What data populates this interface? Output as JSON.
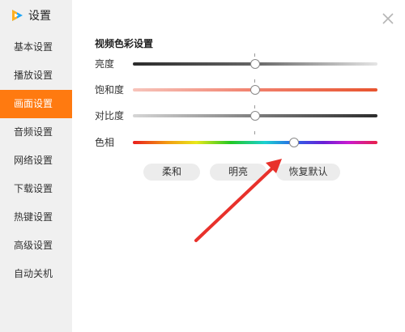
{
  "app": {
    "title": "设置",
    "logo_icon": "tencent-video-logo-icon",
    "accent_color": "#ff7a10"
  },
  "sidebar": {
    "items": [
      {
        "label": "基本设置"
      },
      {
        "label": "播放设置"
      },
      {
        "label": "画面设置",
        "active": true
      },
      {
        "label": "音频设置"
      },
      {
        "label": "网络设置"
      },
      {
        "label": "下载设置"
      },
      {
        "label": "热键设置"
      },
      {
        "label": "高级设置"
      },
      {
        "label": "自动关机"
      }
    ]
  },
  "close_icon": "close-icon",
  "video_color": {
    "title": "视频色彩设置",
    "sliders": [
      {
        "key": "brightness",
        "label": "亮度",
        "value": 0.5
      },
      {
        "key": "saturation",
        "label": "饱和度",
        "value": 0.5
      },
      {
        "key": "contrast",
        "label": "对比度",
        "value": 0.5
      },
      {
        "key": "hue",
        "label": "色相",
        "value": 0.66
      }
    ],
    "buttons": [
      {
        "label": "柔和"
      },
      {
        "label": "明亮"
      },
      {
        "label": "恢复默认"
      }
    ]
  },
  "annotation": {
    "type": "red-arrow",
    "color": "#e8312b"
  }
}
